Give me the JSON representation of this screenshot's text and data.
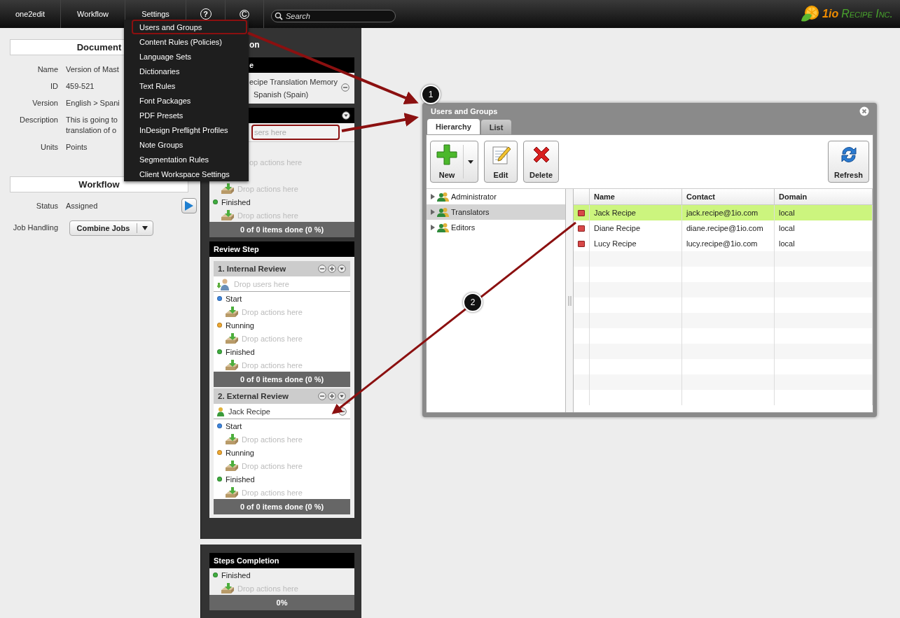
{
  "topbar": {
    "items": [
      {
        "kind": "text",
        "label": "one2edit"
      },
      {
        "kind": "text",
        "label": "Workflow"
      },
      {
        "kind": "text",
        "label": "Settings"
      },
      {
        "kind": "round",
        "label": "?"
      },
      {
        "kind": "glyph",
        "label": "©"
      }
    ],
    "search": {
      "placeholder": "Search"
    },
    "logo": {
      "brand": "1io",
      "name": "Recipe Inc."
    }
  },
  "settings_menu": {
    "items": [
      {
        "label": "Users and Groups",
        "highlighted": true
      },
      {
        "label": "Content Rules (Policies)",
        "highlighted": false
      },
      {
        "label": "Language Sets",
        "highlighted": false
      },
      {
        "label": "Dictionaries",
        "highlighted": false
      },
      {
        "label": "Text Rules",
        "highlighted": false
      },
      {
        "label": "Font Packages",
        "highlighted": false
      },
      {
        "label": "PDF Presets",
        "highlighted": false
      },
      {
        "label": "InDesign Preflight Profiles",
        "highlighted": false
      },
      {
        "label": "Note Groups",
        "highlighted": false
      },
      {
        "label": "Segmentation Rules",
        "highlighted": false
      },
      {
        "label": "Client Workspace Settings",
        "highlighted": false
      }
    ]
  },
  "document": {
    "title": "Document",
    "fields": [
      {
        "label": "Name",
        "lines": [
          "Version of Mast"
        ]
      },
      {
        "label": "ID",
        "lines": [
          "459-521"
        ]
      },
      {
        "label": "Version",
        "lines": [
          "English > Spani"
        ]
      },
      {
        "label": "Description",
        "lines": [
          "This is going to",
          "translation of o"
        ]
      },
      {
        "label": "Units",
        "lines": [
          "Points"
        ]
      }
    ]
  },
  "workflow": {
    "title": "Workflow",
    "status": {
      "label": "Status",
      "value": "Assigned"
    },
    "job_handling": {
      "label": "Job Handling",
      "value": "Combine Jobs"
    }
  },
  "translation_step": {
    "title": "on",
    "memory": {
      "header": "e",
      "lines": [
        "ecipe Translation Memory",
        "Spanish (Spain)"
      ]
    },
    "users_field": {
      "placeholder": "sers here",
      "highlighted": true
    },
    "stages": [
      {
        "drop_text": "op actions here",
        "drop_icon": false
      },
      {
        "drop_text": "Drop actions here",
        "drop_icon": true
      },
      {
        "label": "Finished",
        "color": "#3fae3f",
        "drop_text": "Drop actions here",
        "drop_icon": true
      }
    ],
    "footer": "0 of 0 items done (0 %)"
  },
  "review_step": {
    "title": "Review Step",
    "steps": [
      {
        "title": "1. Internal Review",
        "assignee": {
          "kind": "placeholder",
          "text": "Drop users here"
        },
        "stages": [
          {
            "label": "Start",
            "color": "#3d86e0",
            "drop_text": "Drop actions here",
            "drop_icon": true
          },
          {
            "label": "Running",
            "color": "#f0a830",
            "drop_text": "Drop actions here",
            "drop_icon": true
          },
          {
            "label": "Finished",
            "color": "#3fae3f",
            "drop_text": "Drop actions here",
            "drop_icon": true
          }
        ],
        "footer": "0 of 0 items done (0 %)"
      },
      {
        "title": "2. External Review",
        "assignee": {
          "kind": "user",
          "text": "Jack Recipe"
        },
        "stages": [
          {
            "label": "Start",
            "color": "#3d86e0",
            "drop_text": "Drop actions here",
            "drop_icon": true
          },
          {
            "label": "Running",
            "color": "#f0a830",
            "drop_text": "Drop actions here",
            "drop_icon": true
          },
          {
            "label": "Finished",
            "color": "#3fae3f",
            "drop_text": "Drop actions here",
            "drop_icon": true
          }
        ],
        "footer": "0 of 0 items done (0 %)"
      }
    ]
  },
  "steps_completion": {
    "title": "Steps Completion",
    "stages": [
      {
        "label": "Finished",
        "color": "#3fae3f",
        "drop_text": "Drop actions here",
        "drop_icon": true
      }
    ],
    "footer": "0%"
  },
  "dialog": {
    "title": "Users and Groups",
    "tabs": [
      {
        "label": "Hierarchy",
        "selected": true
      },
      {
        "label": "List",
        "selected": false
      }
    ],
    "toolbar": [
      {
        "kind": "new",
        "label": "New"
      },
      {
        "kind": "edit",
        "label": "Edit"
      },
      {
        "kind": "delete",
        "label": "Delete"
      },
      {
        "kind": "refresh",
        "label": "Refresh"
      }
    ],
    "tree": [
      {
        "label": "Administrator",
        "selected": false,
        "expanded": false
      },
      {
        "label": "Translators",
        "selected": true,
        "expanded": false
      },
      {
        "label": "Editors",
        "selected": false,
        "expanded": false
      }
    ],
    "table": {
      "columns": [
        "Name",
        "Contact",
        "Domain"
      ],
      "rows": [
        {
          "name": "Jack Recipe",
          "contact": "jack.recipe@1io.com",
          "domain": "local",
          "selected": true
        },
        {
          "name": "Diane Recipe",
          "contact": "diane.recipe@1io.com",
          "domain": "local",
          "selected": false
        },
        {
          "name": "Lucy Recipe",
          "contact": "lucy.recipe@1io.com",
          "domain": "local",
          "selected": false
        }
      ]
    }
  },
  "callouts": [
    {
      "label": "1"
    },
    {
      "label": "2"
    }
  ]
}
